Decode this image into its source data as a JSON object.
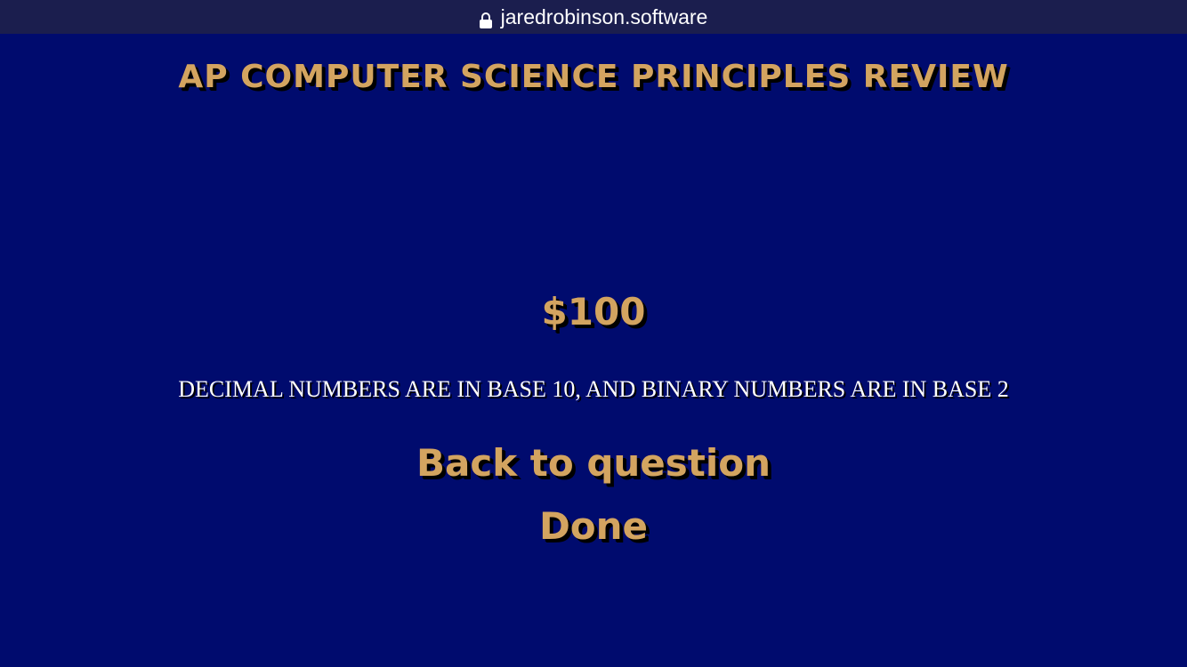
{
  "browser": {
    "url": "jaredrobinson.software",
    "lock_icon": "lock-icon"
  },
  "page": {
    "title": "AP COMPUTER SCIENCE PRINCIPLES REVIEW",
    "value": "$100",
    "answer": "DECIMAL NUMBERS ARE IN BASE 10, AND BINARY NUMBERS ARE IN BASE 2",
    "back_label": "Back to question",
    "done_label": "Done"
  },
  "colors": {
    "background": "#000B6E",
    "url_bar": "#1B1E4E",
    "gold": "#D3A460",
    "answer_text": "#FFFFFF"
  }
}
